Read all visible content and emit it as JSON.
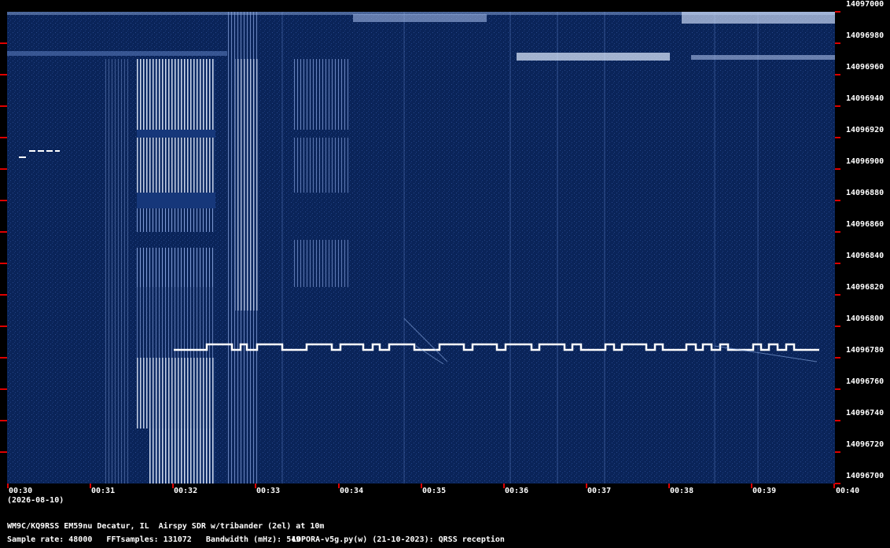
{
  "y_axis": {
    "labels": [
      "14097000",
      "14096980",
      "14096960",
      "14096940",
      "14096920",
      "14096900",
      "14096880",
      "14096860",
      "14096840",
      "14096820",
      "14096800",
      "14096780",
      "14096760",
      "14096740",
      "14096720",
      "14096700"
    ]
  },
  "x_axis": {
    "labels": [
      "00:30",
      "00:31",
      "00:32",
      "00:33",
      "00:34",
      "00:35",
      "00:36",
      "00:37",
      "00:38",
      "00:39",
      "00:40"
    ]
  },
  "date": "(2026-08-10)",
  "footer": {
    "station": "WM9C/KQ9RSS EM59nu Decatur, IL  Airspy SDR w/tribander (2el) at 10m",
    "params": "Sample rate: 48000   FFTsamples: 131072   Bandwidth (mHz): 549",
    "software": "LOPORA-v5g.py(w) (21-10-2023): QRSS reception"
  },
  "colors": {
    "background": "#000000",
    "waterfall": "#0a2459",
    "signal": "#ffffff",
    "ticks": "#dd0000"
  }
}
